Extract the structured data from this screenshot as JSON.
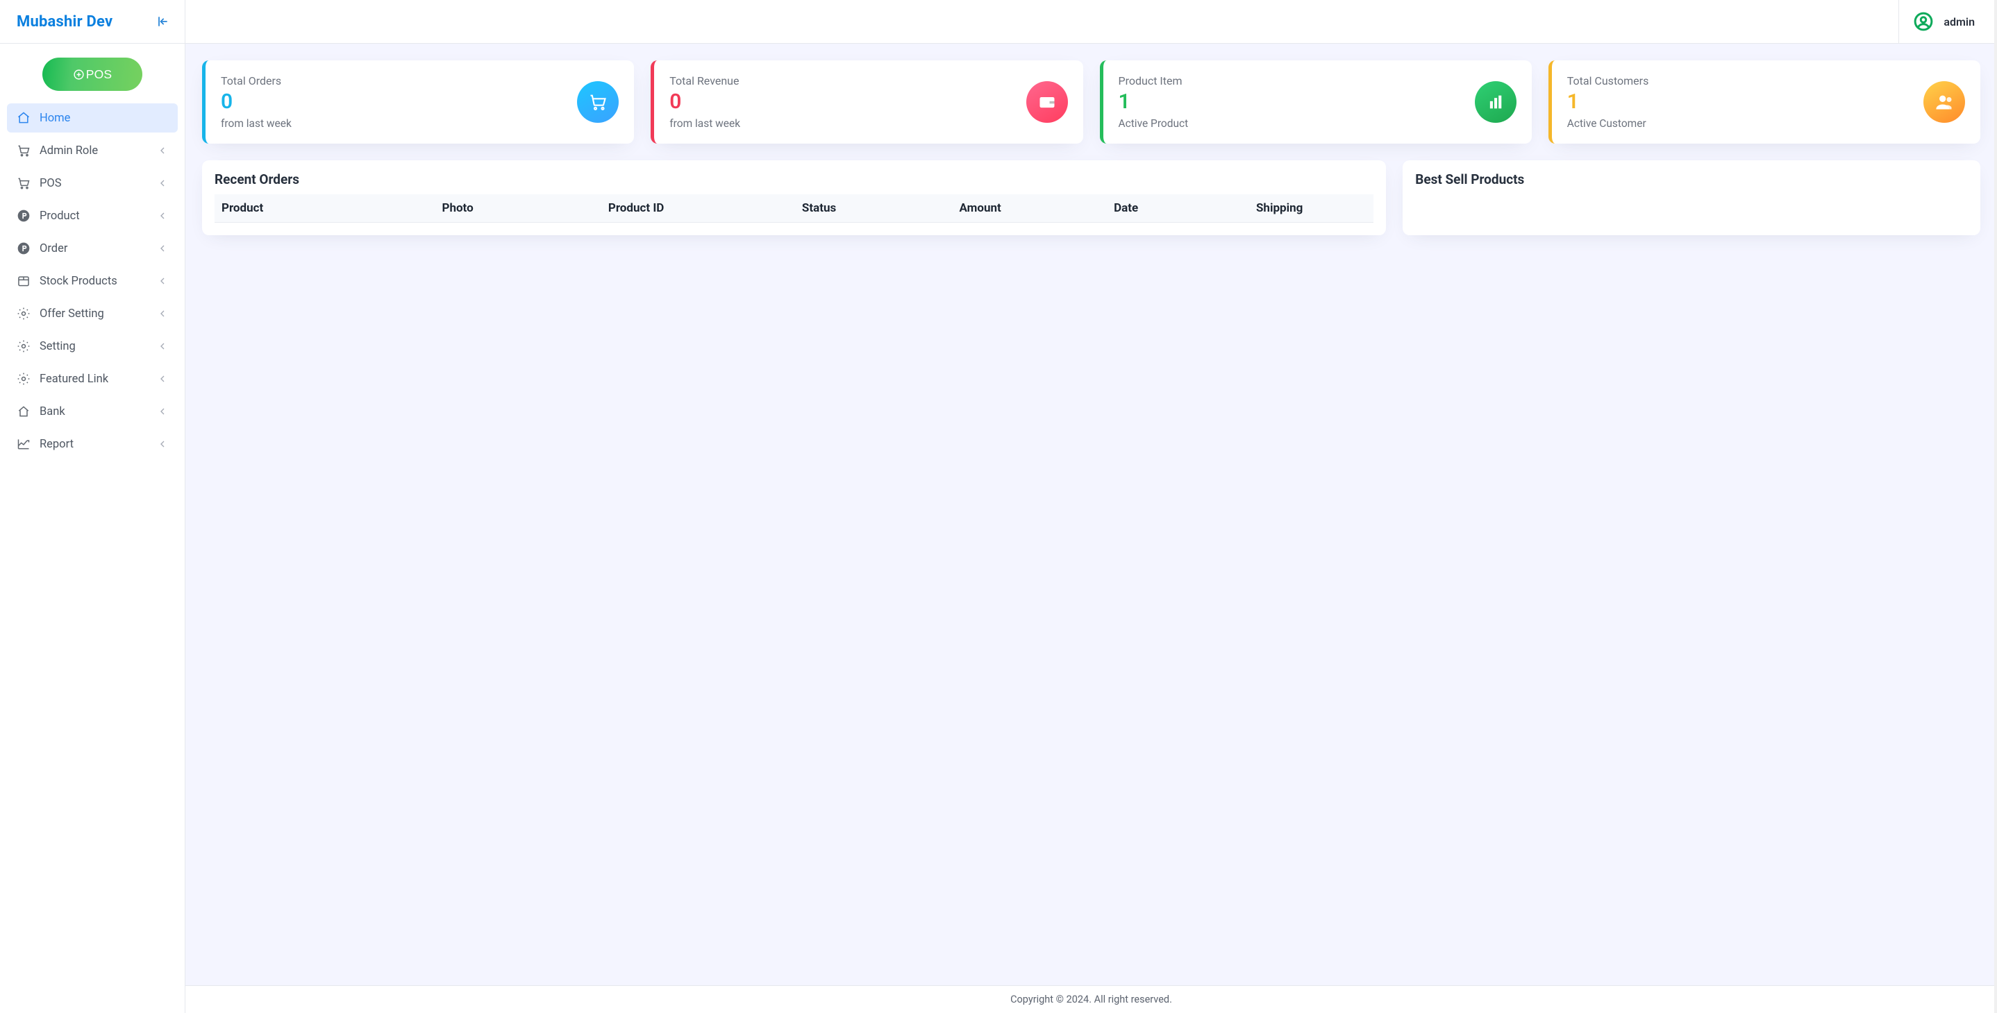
{
  "brand": "Mubashir Dev",
  "user": {
    "name": "admin"
  },
  "sidebar": {
    "posButton": "POS",
    "items": [
      {
        "icon": "home",
        "label": "Home",
        "active": true,
        "expandable": false
      },
      {
        "icon": "cart",
        "label": "Admin Role",
        "active": false,
        "expandable": true
      },
      {
        "icon": "cart",
        "label": "POS",
        "active": false,
        "expandable": true
      },
      {
        "icon": "p-circle",
        "label": "Product",
        "active": false,
        "expandable": true
      },
      {
        "icon": "p-circle",
        "label": "Order",
        "active": false,
        "expandable": true
      },
      {
        "icon": "box",
        "label": "Stock Products",
        "active": false,
        "expandable": true
      },
      {
        "icon": "gear",
        "label": "Offer Setting",
        "active": false,
        "expandable": true
      },
      {
        "icon": "gear",
        "label": "Setting",
        "active": false,
        "expandable": true
      },
      {
        "icon": "gear",
        "label": "Featured Link",
        "active": false,
        "expandable": true
      },
      {
        "icon": "home-outline",
        "label": "Bank",
        "active": false,
        "expandable": true
      },
      {
        "icon": "chart",
        "label": "Report",
        "active": false,
        "expandable": true
      }
    ]
  },
  "stats": [
    {
      "title": "Total Orders",
      "value": "0",
      "meta": "from last week",
      "icon": "cart",
      "color": "c0"
    },
    {
      "title": "Total Revenue",
      "value": "0",
      "meta": "from last week",
      "icon": "wallet",
      "color": "c1"
    },
    {
      "title": "Product Item",
      "value": "1",
      "meta": "Active Product",
      "icon": "bars",
      "color": "c2"
    },
    {
      "title": "Total Customers",
      "value": "1",
      "meta": "Active Customer",
      "icon": "users",
      "color": "c3"
    }
  ],
  "panels": {
    "recentOrders": {
      "heading": "Recent Orders",
      "columns": [
        "Product",
        "Photo",
        "Product ID",
        "Status",
        "Amount",
        "Date",
        "Shipping"
      ],
      "rows": []
    },
    "bestSell": {
      "heading": "Best Sell Products",
      "rows": []
    }
  },
  "footer": "Copyright © 2024. All right reserved."
}
